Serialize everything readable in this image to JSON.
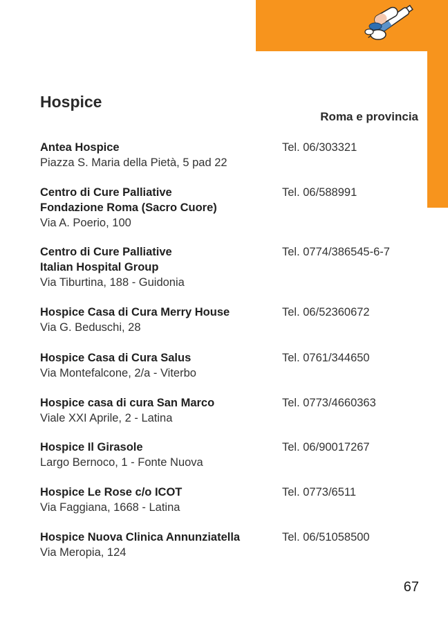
{
  "header": {
    "icon": "pills-syringe-icon",
    "accent_color": "#f7941d"
  },
  "page": {
    "title": "Hospice",
    "region": "Roma e provincia",
    "page_number": "67"
  },
  "entries": [
    {
      "name": "Antea Hospice",
      "address": "Piazza S. Maria della Pietà, 5 pad 22",
      "phone": "Tel. 06/303321"
    },
    {
      "name": "Centro di Cure Palliative",
      "name2": "Fondazione Roma (Sacro Cuore)",
      "address": "Via A. Poerio, 100",
      "phone": "Tel. 06/588991"
    },
    {
      "name": "Centro di Cure Palliative",
      "name2": "Italian Hospital Group",
      "address": "Via Tiburtina, 188 - Guidonia",
      "phone": "Tel. 0774/386545-6-7"
    },
    {
      "name": "Hospice Casa di Cura Merry House",
      "address": "Via G. Beduschi, 28",
      "phone": "Tel. 06/52360672"
    },
    {
      "name": "Hospice Casa di Cura Salus",
      "address": "Via Montefalcone, 2/a - Viterbo",
      "phone": "Tel. 0761/344650"
    },
    {
      "name": "Hospice casa di cura San Marco",
      "address": "Viale XXI Aprile, 2 - Latina",
      "phone": "Tel. 0773/4660363"
    },
    {
      "name": "Hospice Il Girasole",
      "address": "Largo Bernoco, 1 - Fonte Nuova",
      "phone": "Tel. 06/90017267"
    },
    {
      "name": "Hospice Le Rose c/o ICOT",
      "address": "Via Faggiana, 1668 - Latina",
      "phone": "Tel. 0773/6511"
    },
    {
      "name": "Hospice Nuova Clinica Annunziatella",
      "address": "Via Meropia, 124",
      "phone": "Tel. 06/51058500"
    }
  ]
}
